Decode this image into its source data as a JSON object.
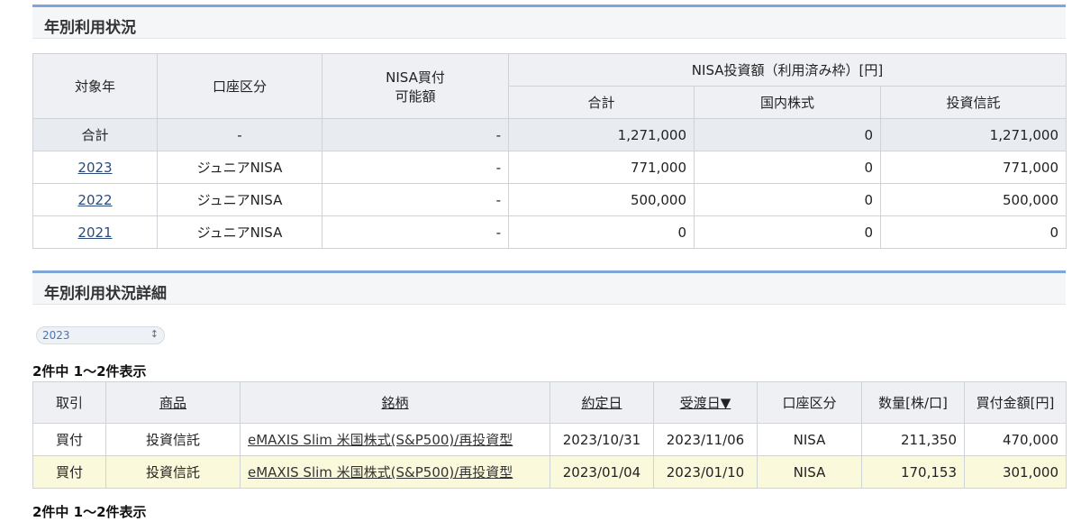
{
  "section1": {
    "title": "年別利用状況"
  },
  "summary": {
    "headers": {
      "year": "対象年",
      "account": "口座区分",
      "nisa_available_l1": "NISA買付",
      "nisa_available_l2": "可能額",
      "nisa_invested": "NISA投資額（利用済み枠）[円]",
      "total": "合計",
      "domestic": "国内株式",
      "trust": "投資信託"
    },
    "rows": [
      {
        "year": "合計",
        "account": "-",
        "available": "-",
        "total": "1,271,000",
        "domestic": "0",
        "trust": "1,271,000"
      },
      {
        "year": "2023",
        "account": "ジュニアNISA",
        "available": "-",
        "total": "771,000",
        "domestic": "0",
        "trust": "771,000"
      },
      {
        "year": "2022",
        "account": "ジュニアNISA",
        "available": "-",
        "total": "500,000",
        "domestic": "0",
        "trust": "500,000"
      },
      {
        "year": "2021",
        "account": "ジュニアNISA",
        "available": "-",
        "total": "0",
        "domestic": "0",
        "trust": "0"
      }
    ]
  },
  "section2": {
    "title": "年別利用状況詳細"
  },
  "year_select": {
    "value": "2023"
  },
  "count_text": "2件中 1〜2件表示",
  "detail": {
    "headers": {
      "trade": "取引",
      "product": "商品",
      "brand": "銘柄",
      "contract_date": "約定日",
      "delivery_date": "受渡日▼",
      "account": "口座区分",
      "quantity": "数量[株/口]",
      "amount": "買付金額[円]"
    },
    "rows": [
      {
        "trade": "買付",
        "product": "投資信託",
        "brand": "eMAXIS Slim 米国株式(S&P500)/再投資型",
        "contract_date": "2023/10/31",
        "delivery_date": "2023/11/06",
        "account": "NISA",
        "quantity": "211,350",
        "amount": "470,000"
      },
      {
        "trade": "買付",
        "product": "投資信託",
        "brand": "eMAXIS Slim 米国株式(S&P500)/再投資型",
        "contract_date": "2023/01/04",
        "delivery_date": "2023/01/10",
        "account": "NISA",
        "quantity": "170,153",
        "amount": "301,000"
      }
    ]
  },
  "colors": {
    "accent": "#7fa7d6",
    "sort_active": "#d64545",
    "row_alt": "#fbf9dc"
  }
}
